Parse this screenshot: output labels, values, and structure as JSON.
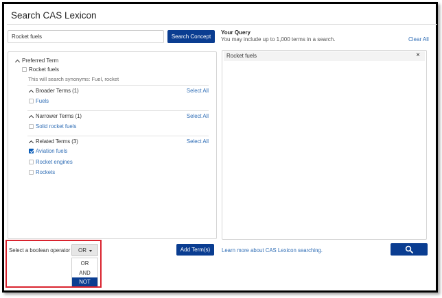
{
  "modal": {
    "title": "Search CAS Lexicon"
  },
  "search": {
    "value": "Rocket fuels",
    "placeholder": "",
    "button_label": "Search Concept"
  },
  "query": {
    "title": "Your Query",
    "subtitle": "You may include up to 1,000 terms in a search.",
    "clear_all": "Clear All",
    "terms": [
      {
        "label": "Rocket fuels",
        "remove_glyph": "×"
      }
    ]
  },
  "preferred": {
    "section_label": "Preferred Term",
    "term": "Rocket fuels",
    "term_checked": false,
    "synonyms_text": "This will search synonyms: Fuel, rocket"
  },
  "groups": [
    {
      "title": "Broader Terms (1)",
      "select_all": "Select All",
      "items": [
        {
          "label": "Fuels",
          "checked": false
        }
      ]
    },
    {
      "title": "Narrower Terms (1)",
      "select_all": "Select All",
      "items": [
        {
          "label": "Solid rocket fuels",
          "checked": false
        }
      ]
    },
    {
      "title": "Related Terms (3)",
      "select_all": "Select All",
      "items": [
        {
          "label": "Aviation fuels",
          "checked": true
        },
        {
          "label": "Rocket engines",
          "checked": false
        },
        {
          "label": "Rockets",
          "checked": false
        }
      ]
    }
  ],
  "boolean": {
    "label": "Select a boolean operator",
    "current": "OR",
    "options": [
      "OR",
      "AND",
      "NOT"
    ],
    "highlighted": "NOT"
  },
  "footer": {
    "add_terms": "Add Term(s)",
    "learn_more": "Learn more about CAS Lexicon searching.",
    "search_icon": "search-icon"
  },
  "colors": {
    "primary": "#0a3d91",
    "link": "#2f6db5",
    "highlight_border": "#d9232e",
    "checkbox_checked": "#0a5cb8"
  }
}
